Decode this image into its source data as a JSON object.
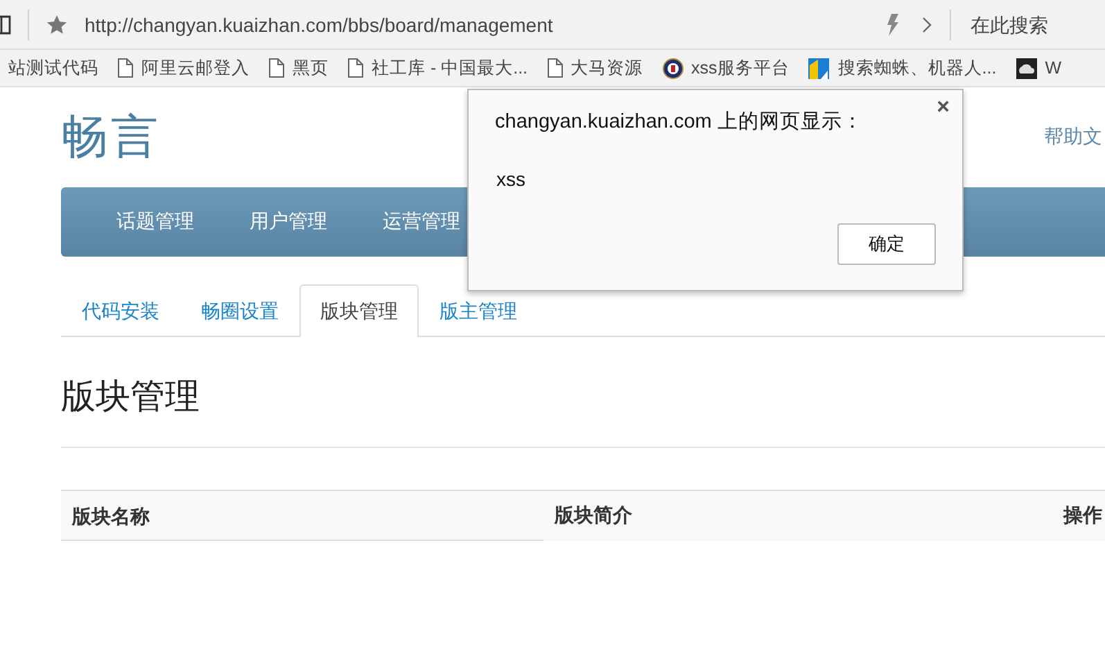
{
  "browser": {
    "url": "http://changyan.kuaizhan.com/bbs/board/management",
    "search": {
      "placeholder": "在此搜索"
    },
    "bookmarks": [
      {
        "label": "站测试代码",
        "kind": "none"
      },
      {
        "label": "阿里云邮登入",
        "kind": "page"
      },
      {
        "label": "黑页",
        "kind": "page"
      },
      {
        "label": "社工库 - 中国最大...",
        "kind": "page"
      },
      {
        "label": "大马资源",
        "kind": "page"
      },
      {
        "label": "xss服务平台",
        "kind": "seal"
      },
      {
        "label": "搜索蜘蛛、机器人...",
        "kind": "tile"
      },
      {
        "label": "W",
        "kind": "cloud"
      }
    ]
  },
  "site": {
    "logo": "畅言",
    "top_links": [
      "帮助文"
    ],
    "nav": [
      "话题管理",
      "用户管理",
      "运营管理"
    ],
    "tabs": [
      {
        "label": "代码安装",
        "selected": false
      },
      {
        "label": "畅圈设置",
        "selected": false
      },
      {
        "label": "版块管理",
        "selected": true
      },
      {
        "label": "版主管理",
        "selected": false
      }
    ],
    "heading": "版块管理",
    "table": {
      "columns": [
        "版块名称",
        "版块简介",
        "操作"
      ]
    }
  },
  "dialog": {
    "title": "changyan.kuaizhan.com 上的网页显示：",
    "message": "xss",
    "close": "×",
    "button": "确定"
  }
}
